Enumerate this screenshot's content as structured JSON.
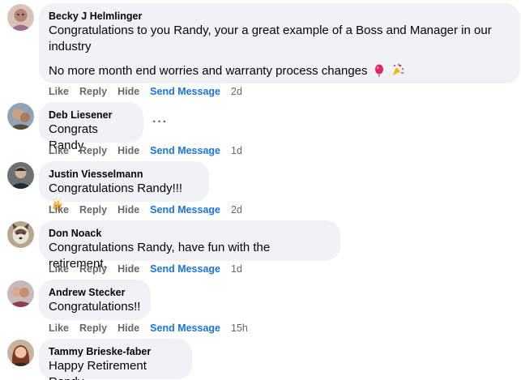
{
  "comments": [
    {
      "author": "Becky J Helmlinger",
      "text": "Congratulations to you Randy, your a great example of a Boss and Manager in our industry",
      "text2": "No more month end worries and warranty process changes",
      "time": "2d",
      "emoji": [
        "balloon-emoji",
        "confetti-emoji"
      ]
    },
    {
      "author": "Deb Liesener",
      "text": "Congrats Randy",
      "time": "1d",
      "more": "···"
    },
    {
      "author": "Justin Viesselmann",
      "text": "Congratulations Randy!!!",
      "time": "2d",
      "emoji": [
        "clapping-hands-emoji"
      ]
    },
    {
      "author": "Don Noack",
      "text": "Congratulations Randy, have fun with the retirement.",
      "time": "1d"
    },
    {
      "author": "Andrew Stecker",
      "text": "Congratulations!!",
      "time": "15h"
    },
    {
      "author": "Tammy Brieske-faber",
      "text": "Happy Retirement Randy"
    }
  ],
  "actions": {
    "like": "Like",
    "reply": "Reply",
    "hide": "Hide",
    "send_message": "Send Message"
  },
  "colors": {
    "bubble": "#f0f2f5",
    "action_text": "#65676b",
    "send_message": "#1b74e4",
    "text": "#050505"
  }
}
